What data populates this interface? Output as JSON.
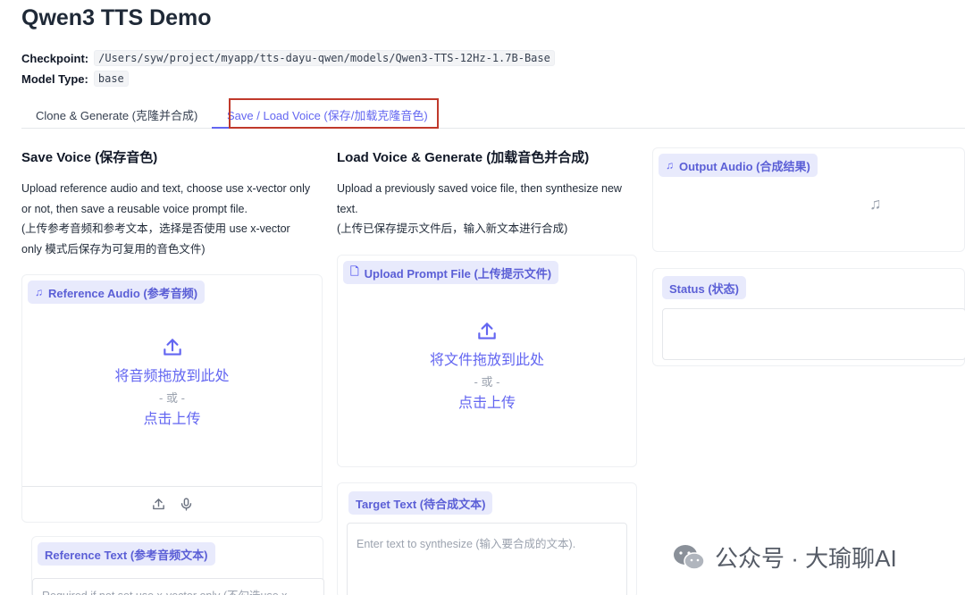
{
  "app": {
    "title": "Qwen3 TTS Demo"
  },
  "meta": {
    "checkpoint_label": "Checkpoint:",
    "checkpoint_value": "/Users/syw/project/myapp/tts-dayu-qwen/models/Qwen3-TTS-12Hz-1.7B-Base",
    "model_type_label": "Model Type:",
    "model_type_value": "base"
  },
  "tabs": [
    {
      "label": "Clone & Generate (克隆并合成)",
      "active": false
    },
    {
      "label": "Save / Load Voice (保存/加载克隆音色)",
      "active": true
    }
  ],
  "save_voice": {
    "title": "Save Voice (保存音色)",
    "desc_line1": "Upload reference audio and text, choose use x-vector only",
    "desc_line2": "or not, then save a reusable voice prompt file.",
    "desc_line3": "(上传参考音频和参考文本，选择是否使用 use x-vector",
    "desc_line4": "only 模式后保存为可复用的音色文件)",
    "ref_audio_label": "Reference Audio (参考音频)",
    "drop_text": "将音频拖放到此处",
    "or_text": "- 或 -",
    "click_upload": "点击上传",
    "ref_text_label": "Reference Text (参考音频文本)",
    "ref_text_placeholder": "Required if not set use x-vector only (不勾选use x-"
  },
  "load_voice": {
    "title": "Load Voice & Generate (加载音色并合成)",
    "desc_line1": "Upload a previously saved voice file, then synthesize new",
    "desc_line2": "text.",
    "desc_line3": "(上传已保存提示文件后，输入新文本进行合成)",
    "upload_label": "Upload Prompt File (上传提示文件)",
    "drop_text": "将文件拖放到此处",
    "or_text": "- 或 -",
    "click_upload": "点击上传",
    "target_text_label": "Target Text (待合成文本)",
    "target_text_placeholder": "Enter text to synthesize (输入要合成的文本)."
  },
  "output": {
    "audio_label": "Output Audio (合成结果)",
    "status_label": "Status (状态)"
  },
  "watermark": {
    "text": "公众号 · 大瑜聊AI"
  },
  "colors": {
    "accent": "#6366f1",
    "chip_bg": "#e8eafc",
    "highlight": "#c0392b"
  }
}
